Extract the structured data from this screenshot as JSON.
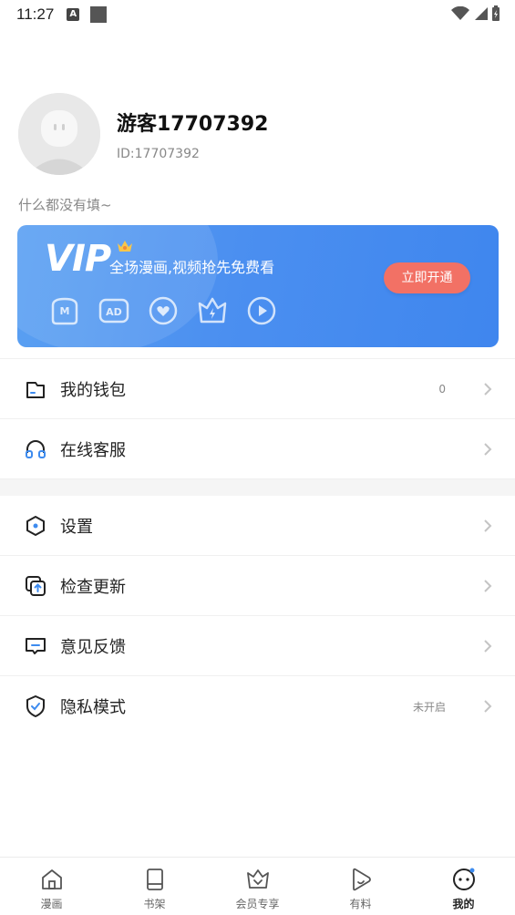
{
  "status_bar": {
    "time": "11:27",
    "a_badge": "A"
  },
  "profile": {
    "username": "游客17707392",
    "user_id": "ID:17707392",
    "bio": "什么都没有填~"
  },
  "vip": {
    "logo": "VIP",
    "slogan": "全场漫画,视频抢先免费看",
    "button": "立即开通",
    "benefit_icons": [
      "m-badge-icon",
      "ad-badge-icon",
      "heart-icon",
      "crown-lightning-icon",
      "play-icon"
    ],
    "colors": {
      "card": "#4b8ff0",
      "button": "#f27165"
    }
  },
  "menu": {
    "wallet": {
      "label": "我的钱包",
      "value": "0",
      "icon": "wallet-icon"
    },
    "support": {
      "label": "在线客服",
      "icon": "headphones-icon"
    },
    "settings": {
      "label": "设置",
      "icon": "hexagon-settings-icon"
    },
    "update": {
      "label": "检查更新",
      "icon": "update-icon"
    },
    "feedback": {
      "label": "意见反馈",
      "icon": "feedback-icon"
    },
    "privacy": {
      "label": "隐私模式",
      "value": "未开启",
      "icon": "shield-check-icon"
    }
  },
  "bottom_nav": {
    "items": [
      {
        "label": "漫画",
        "icon": "home-icon"
      },
      {
        "label": "书架",
        "icon": "book-icon"
      },
      {
        "label": "会员专享",
        "icon": "vip-crown-icon"
      },
      {
        "label": "有料",
        "icon": "play-icon"
      },
      {
        "label": "我的",
        "icon": "face-icon",
        "active": true
      }
    ]
  },
  "colors": {
    "accent_blue": "#3d8bef",
    "text": "#222222",
    "muted": "#888888"
  }
}
